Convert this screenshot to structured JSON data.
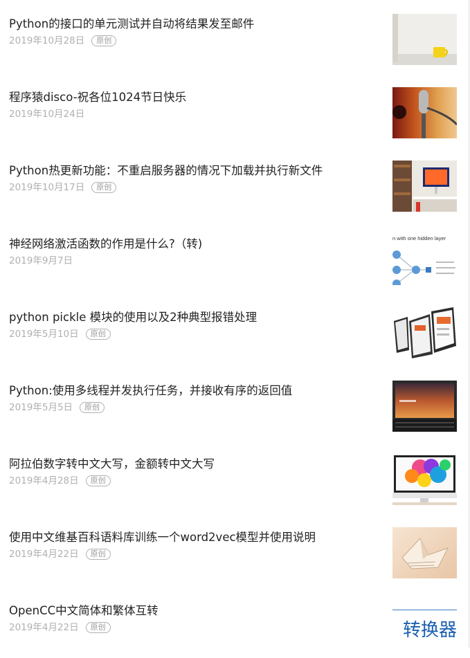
{
  "articles": [
    {
      "title": "Python的接口的单元测试并自动将结果发至邮件",
      "date": "2019年10月28日",
      "badge": "原创"
    },
    {
      "title": "程序猿disco-祝各位1024节日快乐",
      "date": "2019年10月24日",
      "badge": ""
    },
    {
      "title": "Python热更新功能：不重启服务器的情况下加载并执行新文件",
      "date": "2019年10月17日",
      "badge": "原创"
    },
    {
      "title": "神经网络激活函数的作用是什么?（转)",
      "date": "2019年9月7日",
      "badge": ""
    },
    {
      "title": "python pickle 模块的使用以及2种典型报错处理",
      "date": "2019年5月10日",
      "badge": "原创"
    },
    {
      "title": "Python:使用多线程并发执行任务，并接收有序的返回值",
      "date": "2019年5月5日",
      "badge": "原创"
    },
    {
      "title": "阿拉伯数字转中文大写，金额转中文大写",
      "date": "2019年4月28日",
      "badge": "原创"
    },
    {
      "title": "使用中文维基百科语料库训练一个word2vec模型并使用说明",
      "date": "2019年4月22日",
      "badge": "原创"
    },
    {
      "title": "OpenCC中文简体和繁体互转",
      "date": "2019年4月22日",
      "badge": "原创"
    }
  ],
  "thumbs": {
    "nn_caption": "n with one hidden layer",
    "opencc_text": "转换器"
  }
}
